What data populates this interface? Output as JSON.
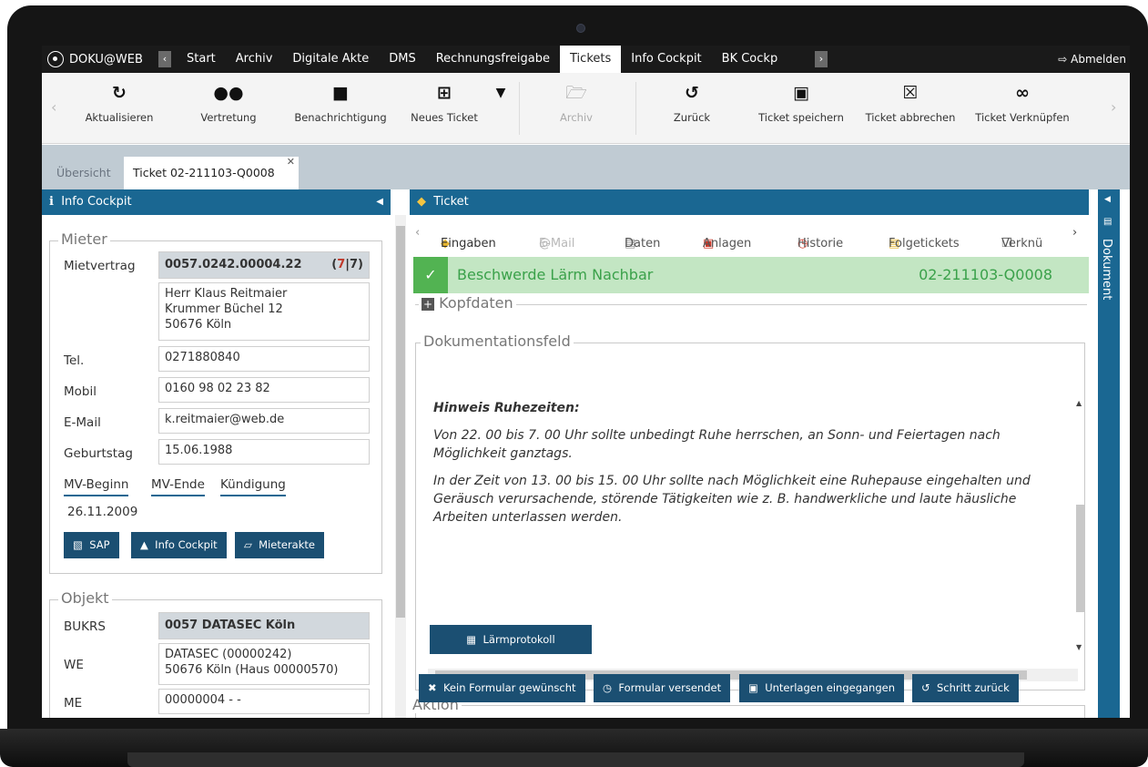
{
  "app": {
    "brand": "DOKU@WEB",
    "logout": "Abmelden"
  },
  "topnav": {
    "items": [
      "Start",
      "Archiv",
      "Digitale Akte",
      "DMS",
      "Rechnungsfreigabe",
      "Tickets",
      "Info Cockpit",
      "BK Cockp"
    ],
    "active": "Tickets"
  },
  "toolbar": {
    "buttons": [
      {
        "label": "Aktualisieren",
        "icon": "refresh-icon"
      },
      {
        "label": "Vertretung",
        "icon": "users-icon"
      },
      {
        "label": "Benachrichtigung",
        "icon": "comment-icon"
      },
      {
        "label": "Neues Ticket",
        "icon": "add-ticket-icon"
      },
      {
        "label": "Archiv",
        "icon": "folder-open-icon"
      },
      {
        "label": "Zurück",
        "icon": "undo-icon"
      },
      {
        "label": "Ticket speichern",
        "icon": "save-icon"
      },
      {
        "label": "Ticket abbrechen",
        "icon": "cancel-ticket-icon"
      },
      {
        "label": "Ticket Verknüpfen",
        "icon": "link-icon"
      }
    ]
  },
  "tabs": {
    "overview": "Übersicht",
    "ticket": "Ticket 02-211103-Q0008"
  },
  "left": {
    "header": "Info Cockpit",
    "mieter": {
      "legend": "Mieter",
      "mietvertrag_label": "Mietvertrag",
      "mietvertrag": "0057.0242.00004.22",
      "count_a": "7",
      "count_b": "7",
      "address": [
        "Herr Klaus Reitmaier",
        "Krummer Büchel 12",
        "50676 Köln"
      ],
      "tel_label": "Tel.",
      "tel": "0271880840",
      "mobil_label": "Mobil",
      "mobil": "0160 98 02 23 82",
      "email_label": "E-Mail",
      "email": "k.reitmaier@web.de",
      "geb_label": "Geburtstag",
      "geb": "15.06.1988",
      "mv_tabs": [
        "MV-Beginn",
        "MV-Ende",
        "Kündigung"
      ],
      "mv_beginn": "26.11.2009",
      "buttons": [
        "SAP",
        "Info Cockpit",
        "Mieterakte"
      ]
    },
    "objekt": {
      "legend": "Objekt",
      "bukrs_label": "BUKRS",
      "bukrs": "0057 DATASEC Köln",
      "we_label": "WE",
      "we": [
        "DATASEC (00000242)",
        "50676 Köln (Haus 00000570)"
      ],
      "me_label": "ME",
      "me": "00000004 - -"
    }
  },
  "center": {
    "header": "Ticket",
    "tabs": [
      "Eingaben",
      "E-Mail",
      "Daten",
      "Anlagen",
      "Historie",
      "Folgetickets",
      "Verknü"
    ],
    "status_title": "Beschwerde Lärm Nachbar",
    "ticket_id": "02-211103-Q0008",
    "kopfdaten": "Kopfdaten",
    "doc_legend": "Dokumentationsfeld",
    "doc_heading": "Hinweis Ruhezeiten:",
    "doc_p1": "Von 22. 00 bis 7. 00 Uhr sollte unbedingt Ruhe herrschen, an Sonn- und Feiertagen nach Möglichkeit ganztags.",
    "doc_p2": "In der Zeit von 13. 00 bis 15. 00 Uhr sollte nach Möglichkeit eine Ruhepause eingehalten und Geräusch verursachende, störende Tätigkeiten wie z. B. handwerkliche und laute häusliche Arbeiten unterlassen werden.",
    "laermprotokoll": "Lärmprotokoll",
    "aktion_legend": "Aktion",
    "actions": [
      "Kein Formular gewünscht",
      "Formular versendet",
      "Unterlagen eingegangen",
      "Schritt zurück"
    ]
  },
  "right": {
    "label": "Dokument"
  }
}
